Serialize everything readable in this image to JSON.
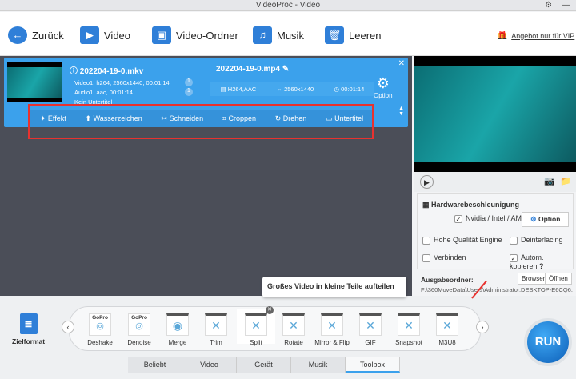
{
  "window": {
    "title": "VideoProc - Video"
  },
  "toolbar": {
    "back": "Zurück",
    "video": "Video",
    "folder": "Video-Ordner",
    "music": "Musik",
    "clear": "Leeren",
    "vip": "Angebot nur für VIP"
  },
  "card": {
    "source_name": "202204-19-0.mkv",
    "video_info": "Video1: h264, 2560x1440, 00:01:14",
    "audio_info": "Audio1: aac, 00:01:14",
    "subtitle_info": "Kein Untertitel",
    "video_track": "1",
    "audio_track": "1",
    "output_name": "202204-19-0.mp4",
    "codec": "H264,AAC",
    "resolution": "2560x1440",
    "duration": "00:01:14",
    "option": "Option",
    "codec_icon_text": "codec"
  },
  "edit_tools": [
    "Effekt",
    "Wasserzeichen",
    "Schneiden",
    "Croppen",
    "Drehen",
    "Untertitel"
  ],
  "settings": {
    "hw_title": "Hardwarebeschleunigung",
    "hw_option": "Nvidia / Intel / AMD",
    "option_btn": "Option",
    "high_quality": "Hohe Qualität Engine",
    "deinterlacing": "Deinterlacing",
    "merge": "Verbinden",
    "auto_copy": "Autom. kopieren",
    "help": "?",
    "output_label": "Ausgabeordner:",
    "browse": "Browsen",
    "open": "Öffnen",
    "output_path": "F:\\360MoveData\\Users\\Administrator.DESKTOP-E6CQ6..."
  },
  "tooltip": "Großes Video in kleine Teile aufteilen",
  "target_format": "Zielformat",
  "tools": [
    "Deshake",
    "Denoise",
    "Merge",
    "Trim",
    "Split",
    "Rotate",
    "Mirror & Flip",
    "GIF",
    "Snapshot",
    "M3U8"
  ],
  "gopro_label": "GoPro",
  "tabs": [
    "Beliebt",
    "Video",
    "Gerät",
    "Musik",
    "Toolbox"
  ],
  "run": "RUN"
}
